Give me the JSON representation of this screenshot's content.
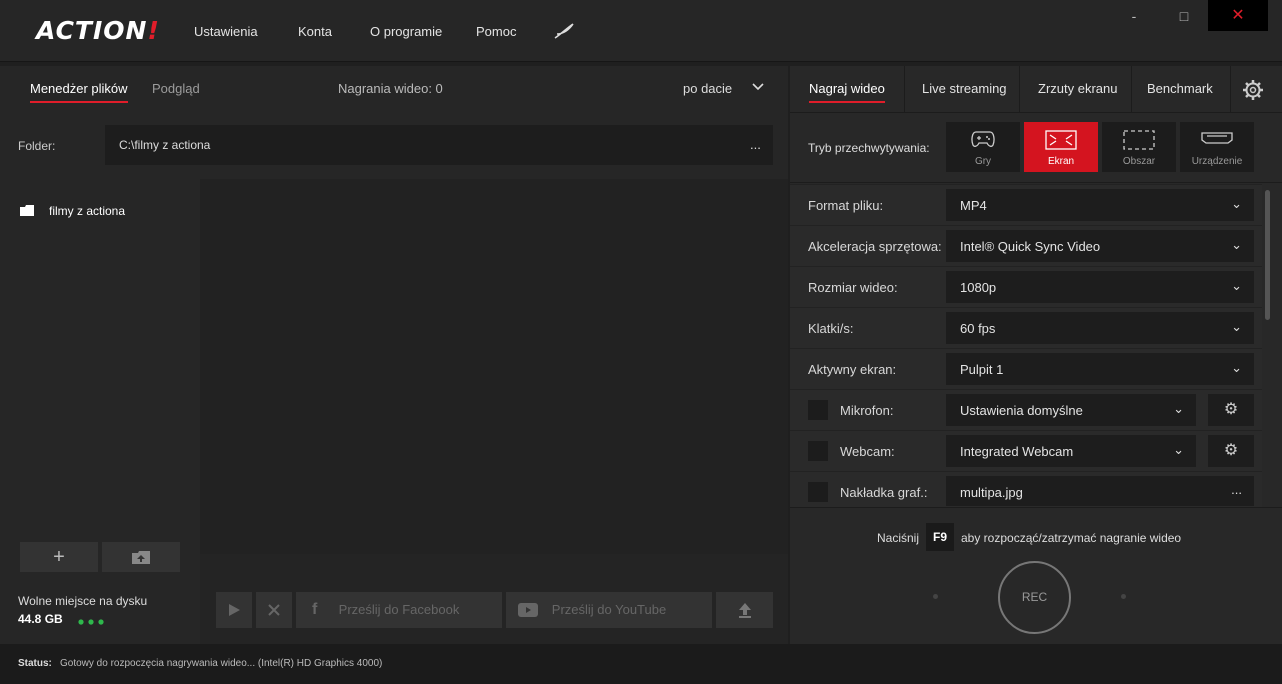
{
  "app": {
    "logo_main": "ACTION",
    "logo_accent": "!"
  },
  "menu": [
    "Ustawienia",
    "Konta",
    "O programie",
    "Pomoc"
  ],
  "window": {
    "minimize": "-",
    "maximize": "□",
    "close": "✕"
  },
  "left": {
    "tabs": [
      "Menedżer plików",
      "Podgląd"
    ],
    "recordings": "Nagrania wideo: 0",
    "sort": "po dacie",
    "folder_label": "Folder:",
    "folder_path": "C:\\filmy z actiona",
    "folder_more": "...",
    "tree_item": "filmy z actiona",
    "disk_label": "Wolne miejsce na dysku",
    "disk_value": "44.8 GB",
    "facebook": "Prześlij do Facebook",
    "youtube": "Prześlij do YouTube"
  },
  "right": {
    "tabs": [
      "Nagraj wideo",
      "Live streaming",
      "Zrzuty ekranu",
      "Benchmark"
    ],
    "capture_label": "Tryb przechwytywania:",
    "modes": [
      "Gry",
      "Ekran",
      "Obszar",
      "Urządzenie"
    ],
    "settings": [
      {
        "label": "Format pliku:",
        "value": "MP4"
      },
      {
        "label": "Akceleracja sprzętowa:",
        "value": "Intel® Quick Sync Video"
      },
      {
        "label": "Rozmiar wideo:",
        "value": "1080p"
      },
      {
        "label": "Klatki/s:",
        "value": "60 fps"
      },
      {
        "label": "Aktywny ekran:",
        "value": "Pulpit 1"
      }
    ],
    "mic_label": "Mikrofon:",
    "mic_value": "Ustawienia domyślne",
    "webcam_label": "Webcam:",
    "webcam_value": "Integrated Webcam",
    "overlay_label": "Nakładka graf.:",
    "overlay_value": "multipa.jpg",
    "overlay_more": "...",
    "press": "Naciśnij",
    "hotkey": "F9",
    "press_hint": "aby rozpocząć/zatrzymać nagranie wideo",
    "rec": "REC"
  },
  "status": {
    "label": "Status:",
    "text": "Gotowy do rozpoczęcia nagrywania wideo... (Intel(R) HD Graphics 4000)"
  },
  "colors": {
    "accent": "#e01d2a",
    "disk_dots": "#2eb84c"
  }
}
